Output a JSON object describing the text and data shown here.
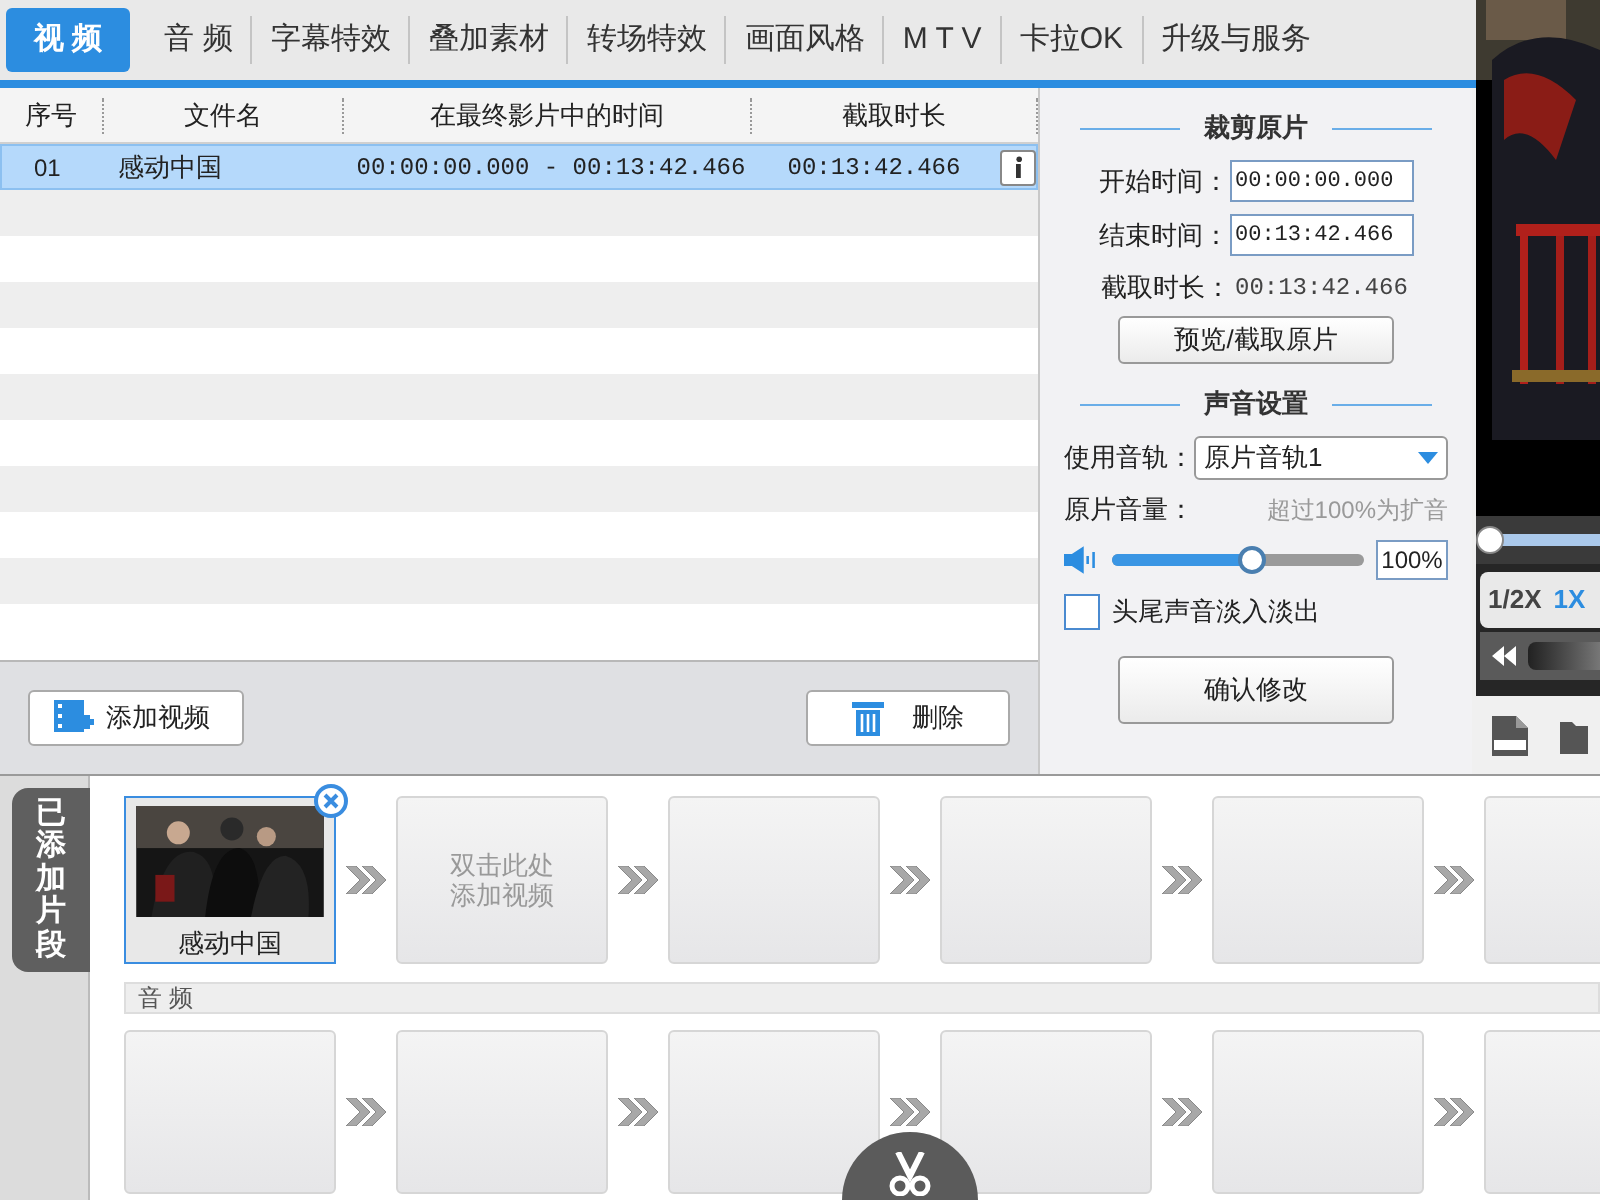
{
  "tabs": [
    {
      "label": "视 频",
      "selected": true
    },
    {
      "label": "音 频",
      "selected": false
    },
    {
      "label": "字幕特效",
      "selected": false
    },
    {
      "label": "叠加素材",
      "selected": false
    },
    {
      "label": "转场特效",
      "selected": false
    },
    {
      "label": "画面风格",
      "selected": false
    },
    {
      "label": "M T V",
      "selected": false
    },
    {
      "label": "卡拉OK",
      "selected": false
    },
    {
      "label": "升级与服务",
      "selected": false
    }
  ],
  "table": {
    "columns": [
      "序号",
      "文件名",
      "在最终影片中的时间",
      "截取时长"
    ],
    "rows": [
      {
        "index": "01",
        "file_name": "感动中国",
        "timeline_time": "00:00:00.000 - 00:13:42.466",
        "duration": "00:13:42.466",
        "selected": true
      }
    ]
  },
  "add_button": "添加视频",
  "delete_button": "删除",
  "trim": {
    "title": "裁剪原片",
    "start_label": "开始时间：",
    "start_value": "00:00:00.000",
    "end_label": "结束时间：",
    "end_value": "00:13:42.466",
    "duration_label": "截取时长：",
    "duration_value": "00:13:42.466",
    "preview_button": "预览/截取原片"
  },
  "audio_settings": {
    "title": "声音设置",
    "track_label": "使用音轨：",
    "track_value": "原片音轨1",
    "volume_label": "原片音量：",
    "volume_hint": "超过100%为扩音",
    "volume": {
      "level": 0.56
    },
    "volume_value": "100%",
    "fade": {
      "label": "头尾声音淡入淡出",
      "checked": false
    },
    "confirm_button": "确认修改"
  },
  "preview": {
    "seek": {
      "level": 0
    },
    "speed_options": [
      {
        "label": "1/2X",
        "selected": false
      },
      {
        "label": "1X",
        "selected": true
      }
    ]
  },
  "clips_tab": "已添加片段",
  "video_track": [
    {
      "kind": "clip",
      "title": "感动中国",
      "selected": true
    },
    {
      "kind": "hint",
      "text": "双击此处添加视频"
    },
    {
      "kind": "empty"
    },
    {
      "kind": "empty"
    },
    {
      "kind": "empty"
    },
    {
      "kind": "empty"
    }
  ],
  "audio_track": {
    "label": "音 频",
    "slots": [
      {
        "kind": "empty"
      },
      {
        "kind": "empty"
      },
      {
        "kind": "empty"
      },
      {
        "kind": "empty"
      },
      {
        "kind": "empty"
      },
      {
        "kind": "empty"
      }
    ]
  }
}
